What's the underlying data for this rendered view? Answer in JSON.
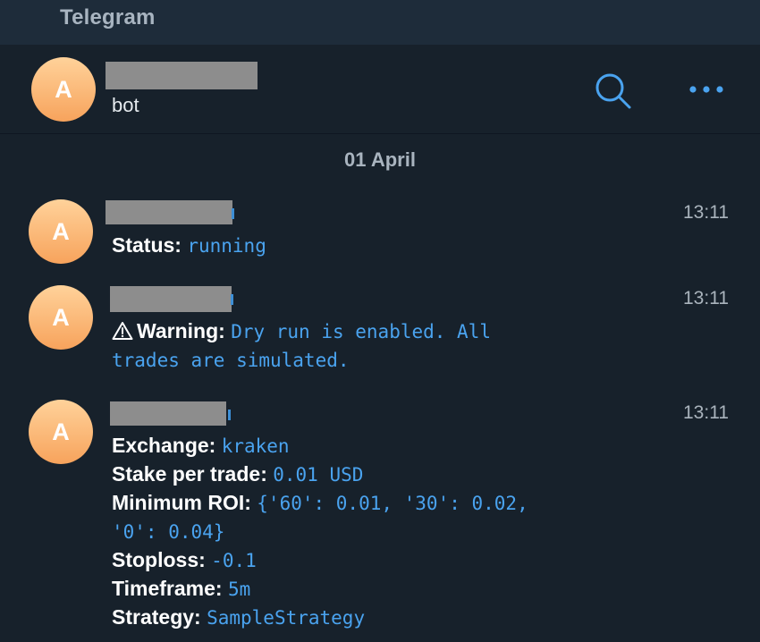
{
  "app": {
    "title": "Telegram"
  },
  "chat": {
    "avatar_letter": "A",
    "subtitle": "bot",
    "search_icon": "search-icon",
    "more_icon": "more-icon"
  },
  "date_separator": "01 April",
  "colors": {
    "background": "#17212b",
    "titlebar": "#1e2c3a",
    "accent": "#4aa3ef",
    "avatar_top": "#ffd29a",
    "avatar_bottom": "#f7a35c"
  },
  "messages": [
    {
      "avatar_letter": "A",
      "time": "13:11",
      "lines": [
        {
          "label": "Status:",
          "value": "running"
        }
      ]
    },
    {
      "avatar_letter": "A",
      "time": "13:11",
      "warning_icon": "warning-icon",
      "lines": [
        {
          "label": "Warning:",
          "value": "Dry run is enabled. All"
        },
        {
          "label": "",
          "value": "trades are simulated."
        }
      ]
    },
    {
      "avatar_letter": "A",
      "time": "13:11",
      "lines": [
        {
          "label": "Exchange:",
          "value": "kraken"
        },
        {
          "label": "Stake per trade:",
          "value": "0.01 USD"
        },
        {
          "label": "Minimum ROI:",
          "value": "{'60': 0.01, '30': 0.02,"
        },
        {
          "label": "",
          "value": "'0': 0.04}"
        },
        {
          "label": "Stoploss:",
          "value": "-0.1"
        },
        {
          "label": "Timeframe:",
          "value": "5m"
        },
        {
          "label": "Strategy:",
          "value": "SampleStrategy"
        }
      ]
    }
  ]
}
